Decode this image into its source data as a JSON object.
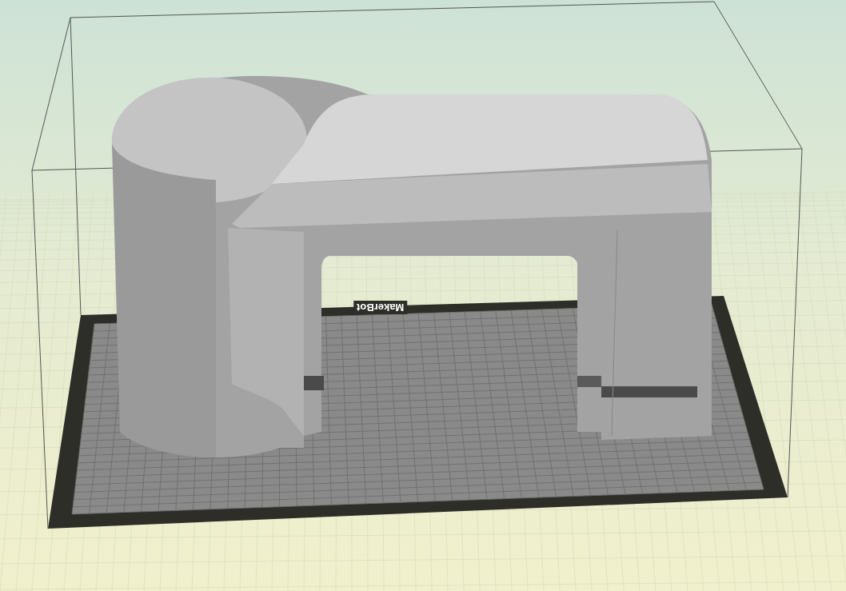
{
  "build_plate": {
    "logo": "MakerBot"
  }
}
